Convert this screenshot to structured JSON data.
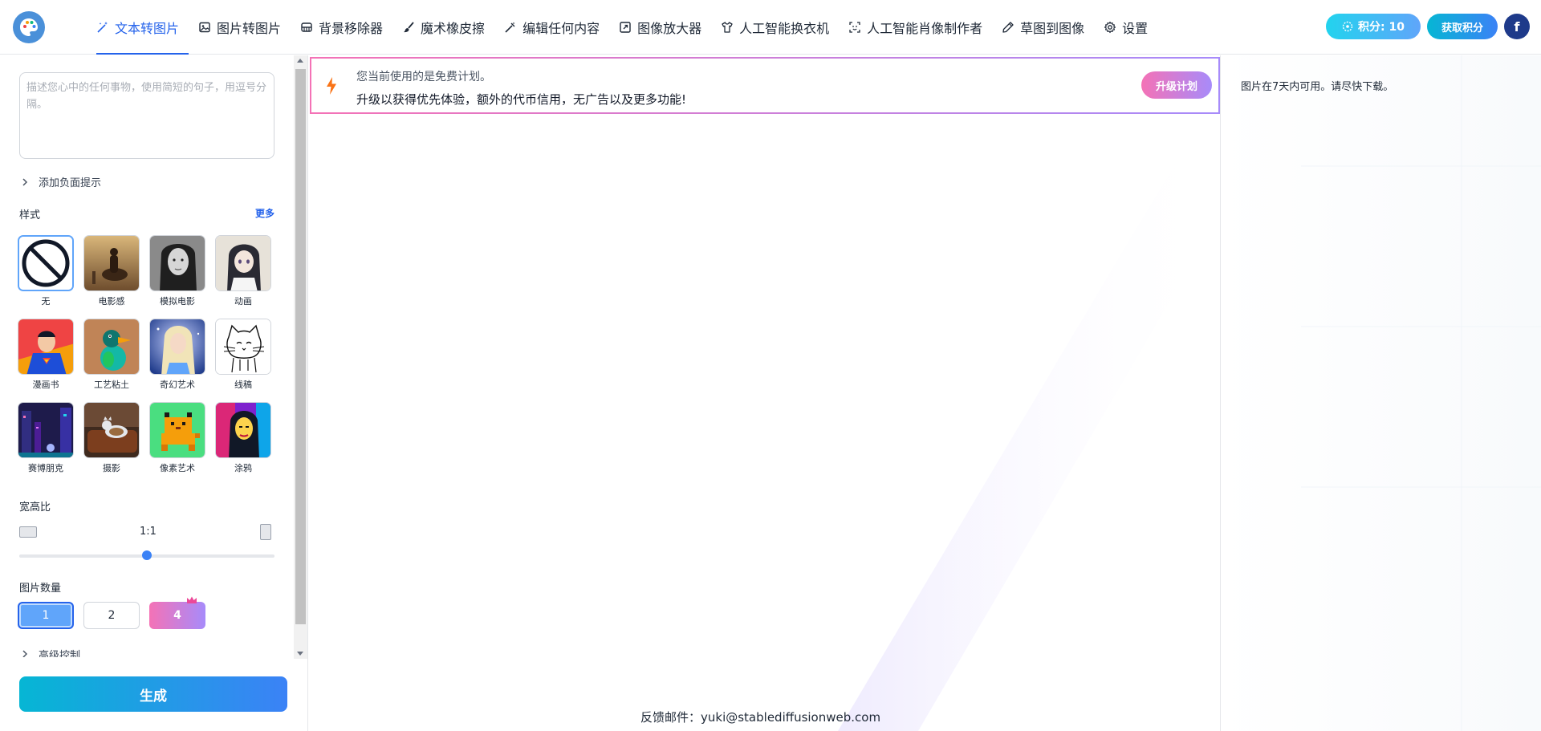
{
  "nav": {
    "items": [
      {
        "label": "文本转图片",
        "icon": "magic-wand-icon",
        "active": true
      },
      {
        "label": "图片转图片",
        "icon": "image-icon"
      },
      {
        "label": "背景移除器",
        "icon": "layers-icon"
      },
      {
        "label": "魔术橡皮擦",
        "icon": "brush-icon"
      },
      {
        "label": "编辑任何内容",
        "icon": "wand-edit-icon"
      },
      {
        "label": "图像放大器",
        "icon": "expand-icon"
      },
      {
        "label": "人工智能换衣机",
        "icon": "shirt-icon"
      },
      {
        "label": "人工智能肖像制作者",
        "icon": "face-scan-icon"
      },
      {
        "label": "草图到图像",
        "icon": "pencil-icon"
      },
      {
        "label": "设置",
        "icon": "gear-icon"
      }
    ]
  },
  "header": {
    "credits_label": "积分: 10",
    "get_credits_label": "获取积分",
    "avatar_letter": "f"
  },
  "left": {
    "prompt_placeholder": "描述您心中的任何事物，使用简短的句子，用逗号分隔。",
    "negative_prompt_label": "添加负面提示",
    "style_label": "样式",
    "more_label": "更多",
    "styles": [
      {
        "name": "无"
      },
      {
        "name": "电影感"
      },
      {
        "name": "模拟电影"
      },
      {
        "name": "动画"
      },
      {
        "name": "漫画书"
      },
      {
        "name": "工艺粘土"
      },
      {
        "name": "奇幻艺术"
      },
      {
        "name": "线稿"
      },
      {
        "name": "赛博朋克"
      },
      {
        "name": "摄影"
      },
      {
        "name": "像素艺术"
      },
      {
        "name": "涂鸦"
      }
    ],
    "selected_style": "无",
    "aspect_label": "宽高比",
    "aspect_value": "1:1",
    "aspect_slider_fraction": 0.5,
    "count_label": "图片数量",
    "counts": [
      "1",
      "2",
      "4"
    ],
    "selected_count": "1",
    "advanced_label": "高级控制",
    "generate_label": "生成"
  },
  "banner": {
    "line1": "您当前使用的是免费计划。",
    "line2": "升级以获得优先体验，额外的代币信用，无广告以及更多功能!",
    "upgrade_label": "升级计划"
  },
  "footer": {
    "feedback": "反馈邮件：yuki@stablediffusionweb.com"
  },
  "right": {
    "note": "图片在7天内可用。请尽快下载。"
  },
  "colors": {
    "accent": "#2563eb",
    "generate_gradient": [
      "#06b6d4",
      "#3b82f6"
    ],
    "premium_gradient": [
      "#f472b6",
      "#a78bfa"
    ]
  }
}
